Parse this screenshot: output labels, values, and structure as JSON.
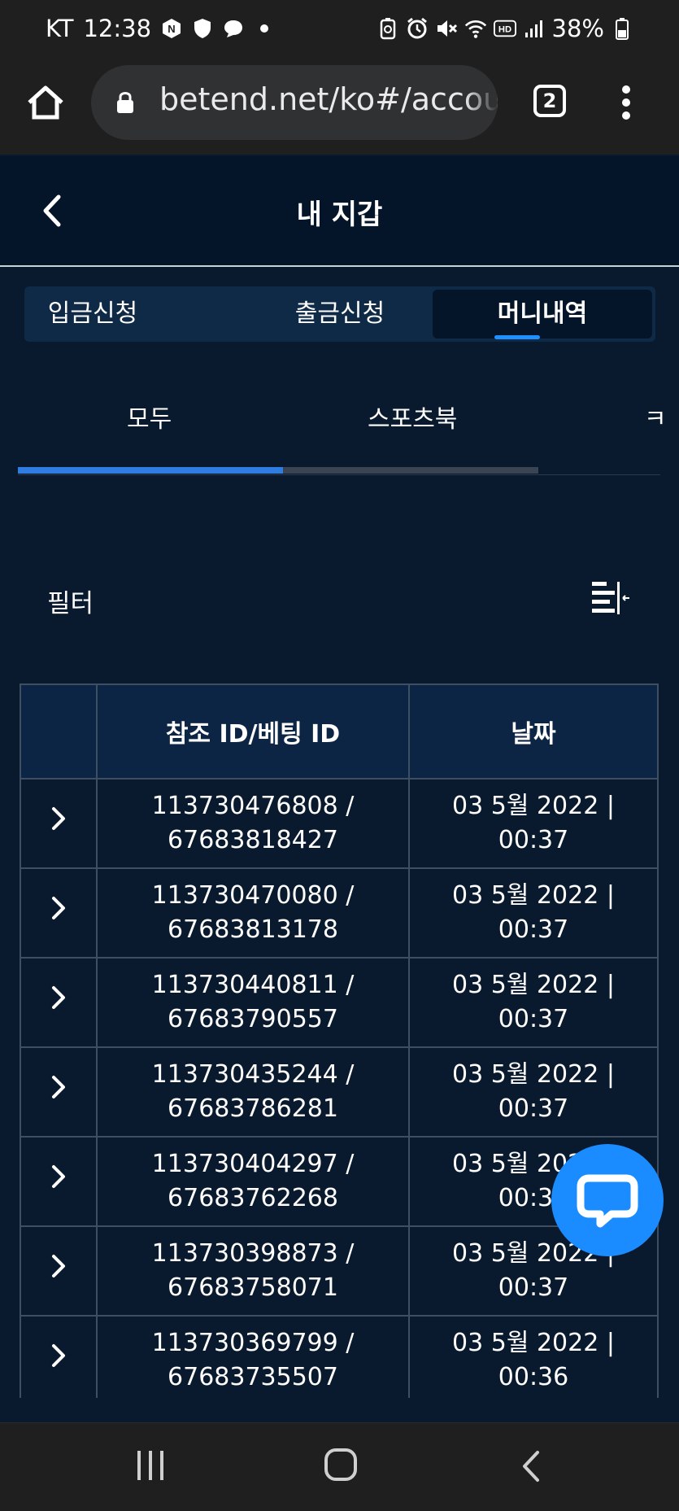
{
  "status_bar": {
    "carrier": "KT",
    "time": "12:38",
    "battery": "38%",
    "icons": [
      "n-icon",
      "shield-icon",
      "chat-status-icon",
      "dot-icon",
      "battery-saver-icon",
      "alarm-icon",
      "mute-icon",
      "wifi-icon",
      "hd-icon",
      "signal-icon",
      "battery-icon"
    ]
  },
  "browser": {
    "url": "betend.net/ko#/accou",
    "tab_count": "2"
  },
  "header": {
    "title": "내 지갑"
  },
  "segments": [
    {
      "label": "입금신청",
      "active": false
    },
    {
      "label": "출금신청",
      "active": false
    },
    {
      "label": "머니내역",
      "active": true
    }
  ],
  "subtabs": [
    {
      "label": "모두",
      "active": true
    },
    {
      "label": "스포츠북",
      "active": false
    },
    {
      "label": "ㅋ",
      "active": false
    }
  ],
  "filter": {
    "label": "필터"
  },
  "table": {
    "columns": [
      "",
      "참조 ID/베팅 ID",
      "날짜"
    ],
    "rows": [
      {
        "ref": "113730476808 /",
        "bet": "67683818427",
        "date": "03 5월 2022 |",
        "time": "00:37"
      },
      {
        "ref": "113730470080 /",
        "bet": "67683813178",
        "date": "03 5월 2022 |",
        "time": "00:37"
      },
      {
        "ref": "113730440811 /",
        "bet": "67683790557",
        "date": "03 5월 2022 |",
        "time": "00:37"
      },
      {
        "ref": "113730435244 /",
        "bet": "67683786281",
        "date": "03 5월 2022 |",
        "time": "00:37"
      },
      {
        "ref": "113730404297 /",
        "bet": "67683762268",
        "date": "03 5월 2022 |",
        "time": "00:37"
      },
      {
        "ref": "113730398873 /",
        "bet": "67683758071",
        "date": "03 5월 2022 |",
        "time": "00:37"
      },
      {
        "ref": "113730369799 /",
        "bet": "67683735507",
        "date": "03 5월 2022 |",
        "time": "00:36"
      }
    ]
  },
  "colors": {
    "background": "#0a1a2e",
    "accent": "#1e90ff",
    "chat_button": "#1a8cff"
  }
}
